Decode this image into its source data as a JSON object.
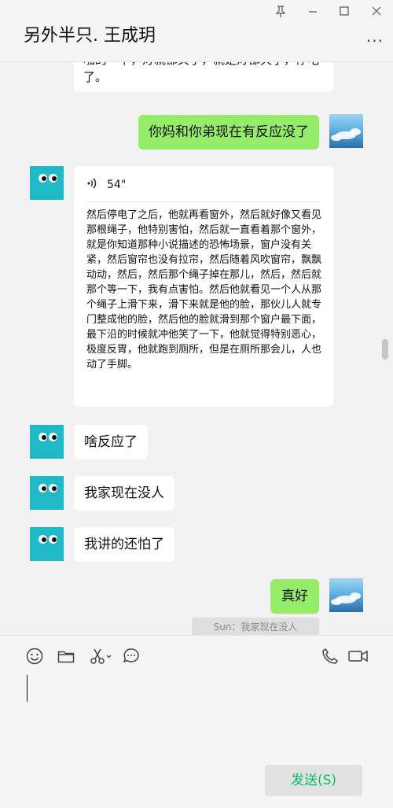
{
  "header": {
    "title": "另外半只. 王成玥",
    "more_label": "···"
  },
  "window_controls": {
    "pin": "pin-icon",
    "minimize": "minimize-icon",
    "maximize": "maximize-icon",
    "close": "close-icon"
  },
  "messages": [
    {
      "side": "left",
      "type": "text",
      "text": "啪的一下，灯就都关了，就是灯都灭了，停电了。"
    },
    {
      "side": "right",
      "type": "text",
      "text": "你妈和你弟现在有反应没了"
    },
    {
      "side": "left",
      "type": "voice",
      "duration": "54\"",
      "transcript": "然后停电了之后，他就再看窗外，然后就好像又看见那根绳子，他特别害怕，然后就一直看着那个窗外，就是你知道那种小说描述的恐怖场景，窗户没有关紧，然后窗帘也没有拉帘，然后随着风吹窗帘，飘飘动动，然后，然后那个绳子掉在那儿，然后，然后就那个等一下，我有点害怕。然后他就看见一个人从那个绳子上滑下来，滑下来就是他的脸，那伙儿人就专门整成他的脸，然后他的脸就滑到那个窗户最下面，最下沿的时候就冲他笑了一下，他就觉得特别恶心，极度反胃，他就跑到厕所，但是在厕所那会儿，人也动了手脚。"
    },
    {
      "side": "left",
      "type": "text",
      "text": "啥反应了"
    },
    {
      "side": "left",
      "type": "text",
      "text": "我家现在没人"
    },
    {
      "side": "left",
      "type": "text",
      "text": "我讲的还怕了"
    },
    {
      "side": "right",
      "type": "text",
      "text": "真好"
    }
  ],
  "system_tip": "Sun：我家现在没人",
  "toolbar": {
    "emoji": "emoji-icon",
    "folder": "folder-icon",
    "scissors": "scissors-icon",
    "chat": "chat-history-icon",
    "phone": "phone-icon",
    "video": "video-icon"
  },
  "send_button": {
    "label": "发送(S)"
  },
  "colors": {
    "bubble_self": "#95ec69",
    "bubble_other": "#ffffff",
    "avatar_teal": "#1fb9c7",
    "send_text": "#07c160"
  }
}
